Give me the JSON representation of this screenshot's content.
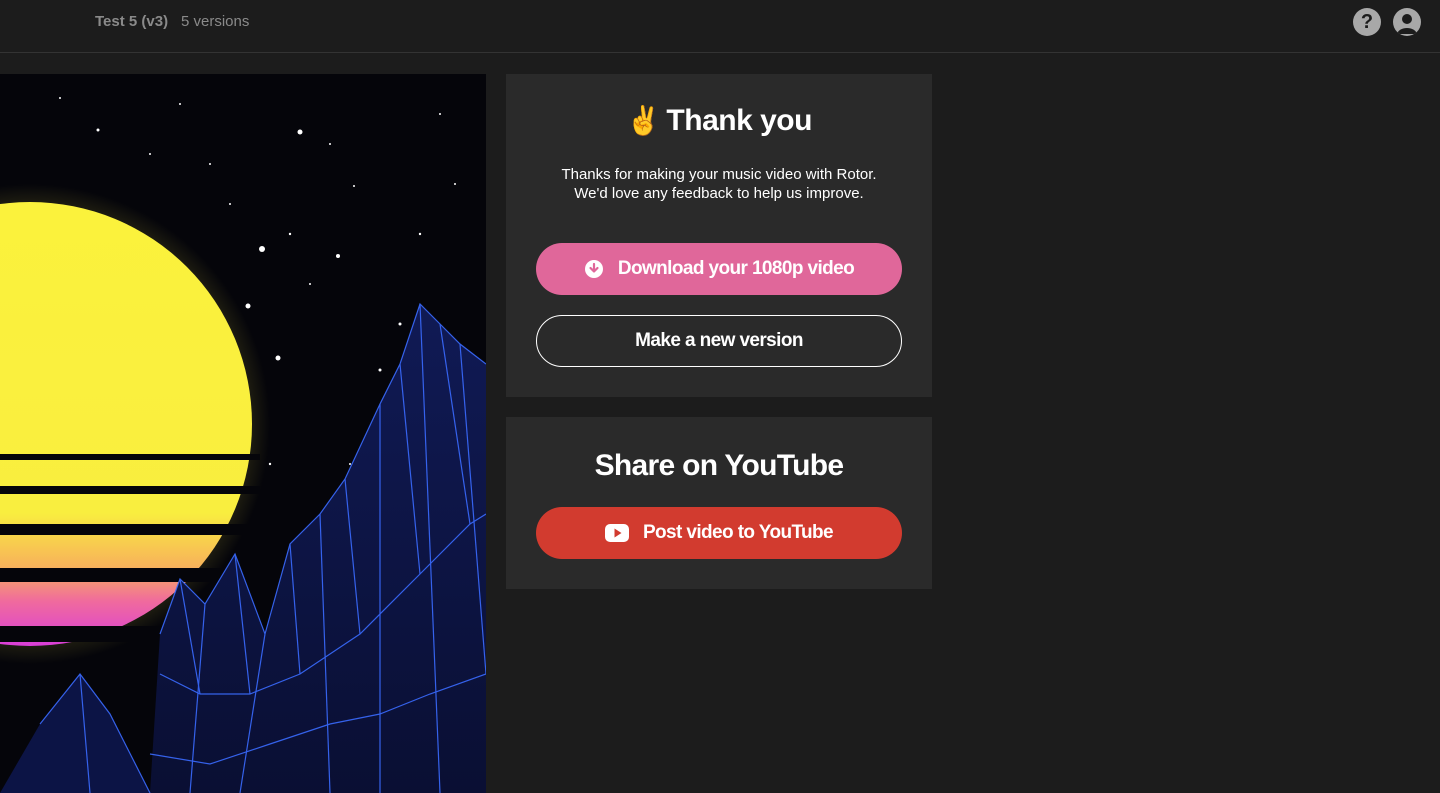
{
  "header": {
    "project_title": "Test 5 (v3)",
    "versions_label": "5 versions",
    "help_icon": "question-circle-icon",
    "user_icon": "user-avatar-icon"
  },
  "thank_you_panel": {
    "emoji": "✌️",
    "heading": "Thank you",
    "message_line1": "Thanks for making your music video with Rotor.",
    "message_line2": "We'd love any feedback to help us improve.",
    "download_button": "Download your 1080p video",
    "download_icon": "download-circle-icon",
    "new_version_button": "Make a new version"
  },
  "share_panel": {
    "heading": "Share on YouTube",
    "youtube_button": "Post video to YouTube",
    "youtube_icon": "youtube-icon"
  },
  "colors": {
    "background": "#1c1c1c",
    "panel": "#2a2a2a",
    "download_accent": "#e0679a",
    "youtube_accent": "#d23b2f"
  }
}
